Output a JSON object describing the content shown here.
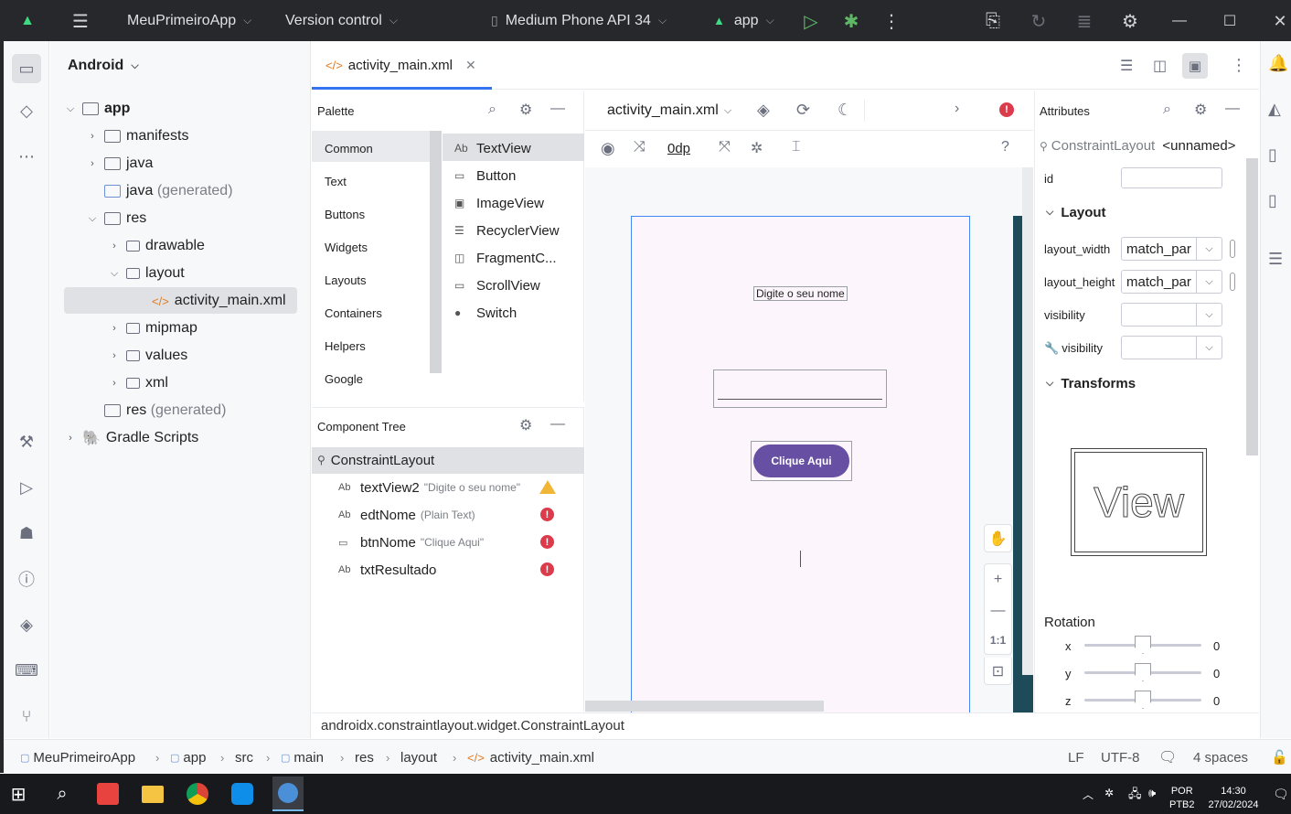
{
  "title_bar": {
    "project_name": "MeuPrimeiroApp",
    "version_control": "Version control",
    "device": "Medium Phone API 34",
    "run_config": "app"
  },
  "project_panel": {
    "view": "Android",
    "tree": [
      {
        "label": "app",
        "extra": ""
      },
      {
        "label": "manifests",
        "extra": ""
      },
      {
        "label": "java",
        "extra": ""
      },
      {
        "label": "java",
        "extra": "(generated)"
      },
      {
        "label": "res",
        "extra": ""
      },
      {
        "label": "drawable",
        "extra": ""
      },
      {
        "label": "layout",
        "extra": ""
      },
      {
        "label": "activity_main.xml",
        "extra": ""
      },
      {
        "label": "mipmap",
        "extra": ""
      },
      {
        "label": "values",
        "extra": ""
      },
      {
        "label": "xml",
        "extra": ""
      },
      {
        "label": "res",
        "extra": "(generated)"
      },
      {
        "label": "Gradle Scripts",
        "extra": ""
      }
    ]
  },
  "editor": {
    "tab_label": "activity_main.xml",
    "file_dropdown": "activity_main.xml",
    "margin_value": "0dp"
  },
  "palette": {
    "title": "Palette",
    "categories": [
      "Common",
      "Text",
      "Buttons",
      "Widgets",
      "Layouts",
      "Containers",
      "Helpers",
      "Google"
    ],
    "items": [
      {
        "icon": "Ab",
        "label": "TextView"
      },
      {
        "icon": "▭",
        "label": "Button"
      },
      {
        "icon": "▣",
        "label": "ImageView"
      },
      {
        "icon": "☰",
        "label": "RecyclerView"
      },
      {
        "icon": "◫",
        "label": "FragmentC..."
      },
      {
        "icon": "▭",
        "label": "ScrollView"
      },
      {
        "icon": "●",
        "label": "Switch"
      }
    ]
  },
  "component_tree": {
    "title": "Component Tree",
    "root": "ConstraintLayout",
    "children": [
      {
        "icon": "Ab",
        "name": "textView2",
        "detail": "\"Digite o seu nome\"",
        "status": "warning"
      },
      {
        "icon": "Ab",
        "name": "edtNome",
        "detail": "(Plain Text)",
        "status": "error"
      },
      {
        "icon": "▭",
        "name": "btnNome",
        "detail": "\"Clique Aqui\"",
        "status": "error"
      },
      {
        "icon": "Ab",
        "name": "txtResultado",
        "detail": "",
        "status": "error"
      }
    ]
  },
  "phone_preview": {
    "textview_text": "Digite o seu nome",
    "button_text": "Clique Aqui",
    "button_color": "#6750a4"
  },
  "zoom_controls": {
    "one_to_one": "1:1"
  },
  "attributes": {
    "title": "Attributes",
    "component_type": "ConstraintLayout",
    "component_name": "<unnamed>",
    "id_label": "id",
    "id_value": "",
    "layout_section": "Layout",
    "layout_width_label": "layout_width",
    "layout_width_value": "match_par",
    "layout_height_label": "layout_height",
    "layout_height_value": "match_par",
    "visibility_label": "visibility",
    "visibility_value": "",
    "tools_visibility_label": "visibility",
    "tools_visibility_value": "",
    "transforms_section": "Transforms",
    "view_preview_text": "View",
    "rotation_label": "Rotation",
    "rotation": [
      {
        "axis": "x",
        "value": "0"
      },
      {
        "axis": "y",
        "value": "0"
      },
      {
        "axis": "z",
        "value": "0"
      }
    ]
  },
  "status_class": "androidx.constraintlayout.widget.ConstraintLayout",
  "breadcrumbs": [
    "MeuPrimeiroApp",
    "app",
    "src",
    "main",
    "res",
    "layout",
    "activity_main.xml"
  ],
  "status_bar": {
    "line_separator": "LF",
    "encoding": "UTF-8",
    "indent": "4 spaces"
  },
  "taskbar": {
    "language": "POR",
    "layout": "PTB2",
    "time": "14:30",
    "date": "27/02/2024"
  },
  "colors": {
    "accent": "#3574f0",
    "error": "#db3b4b",
    "warning": "#f2b637",
    "title_bar": "#27282c"
  }
}
